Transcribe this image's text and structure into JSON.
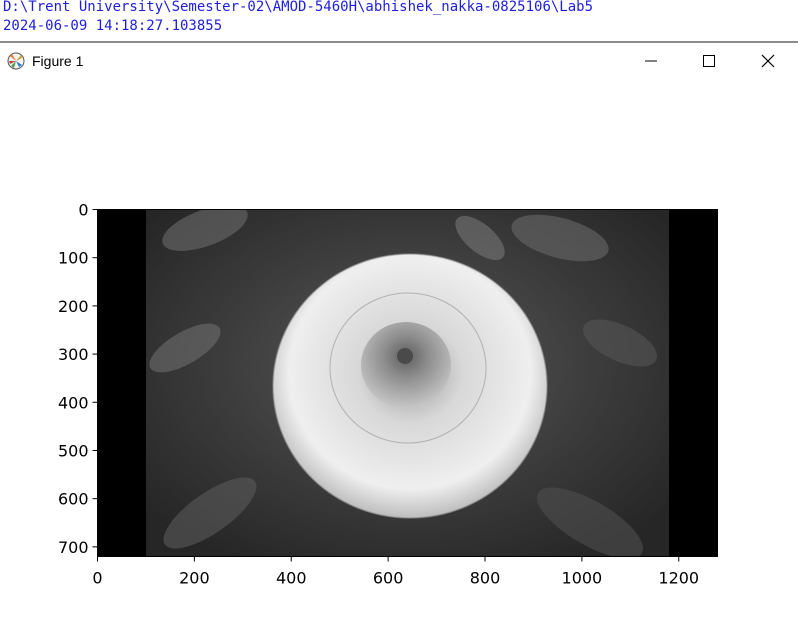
{
  "console": {
    "path_line": "D:\\Trent University\\Semester-02\\AMOD-5460H\\abhishek_nakka-0825106\\Lab5",
    "timestamp_line": "2024-06-09 14:18:27.103855"
  },
  "window": {
    "title": "Figure 1",
    "icon": "matplotlib-icon",
    "controls": {
      "minimize": "minimize-icon",
      "maximize": "maximize-icon",
      "close": "close-icon"
    }
  },
  "figure": {
    "image_description_icon": "grayscale-dahlia-image",
    "x_ticks": [
      "0",
      "200",
      "400",
      "600",
      "800",
      "1000",
      "1200"
    ],
    "y_ticks": [
      "0",
      "100",
      "200",
      "300",
      "400",
      "500",
      "600",
      "700"
    ],
    "x_range": [
      0,
      1280
    ],
    "y_range": [
      720,
      0
    ]
  }
}
